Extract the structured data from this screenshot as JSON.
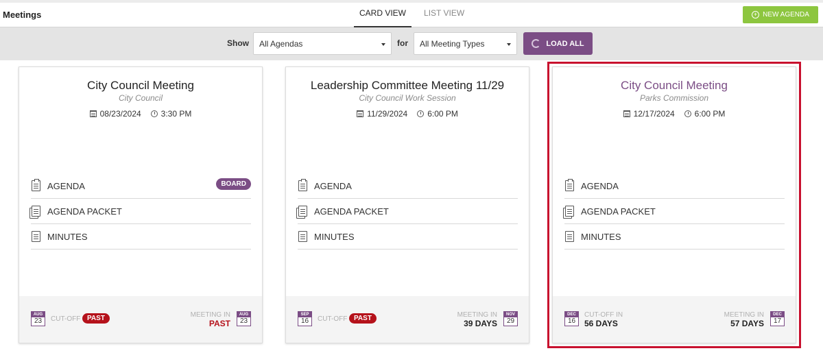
{
  "header": {
    "title": "Meetings",
    "tabs": [
      {
        "label": "CARD VIEW",
        "active": true
      },
      {
        "label": "LIST VIEW",
        "active": false
      }
    ],
    "new_agenda_label": "NEW AGENDA",
    "new_agenda_icon": "plus-circle-icon"
  },
  "filters": {
    "show_label": "Show",
    "agenda_select_value": "All Agendas",
    "for_label": "for",
    "type_select_value": "All Meeting Types",
    "load_all_label": "LOAD ALL"
  },
  "colors": {
    "accent": "#7b4d85",
    "new_agenda": "#8dc63f",
    "past": "#b5121b",
    "highlight_frame": "#c8102e"
  },
  "cards": [
    {
      "title": "City Council Meeting",
      "subtitle": "City Council",
      "date": "08/23/2024",
      "time": "3:30 PM",
      "docs": [
        {
          "label": "AGENDA",
          "badge": "BOARD"
        },
        {
          "label": "AGENDA PACKET"
        },
        {
          "label": "MINUTES"
        }
      ],
      "footer": {
        "cutoff_month": "AUG",
        "cutoff_day": "23",
        "cutoff_label": "CUT-OFF",
        "cutoff_status": "PAST",
        "meeting_in_label": "MEETING IN",
        "meeting_in_value": "PAST",
        "meeting_month": "AUG",
        "meeting_day": "23"
      }
    },
    {
      "title": "Leadership Committee Meeting 11/29",
      "subtitle": "City Council Work Session",
      "date": "11/29/2024",
      "time": "6:00 PM",
      "docs": [
        {
          "label": "AGENDA"
        },
        {
          "label": "AGENDA PACKET"
        },
        {
          "label": "MINUTES"
        }
      ],
      "footer": {
        "cutoff_month": "SEP",
        "cutoff_day": "16",
        "cutoff_label": "CUT-OFF",
        "cutoff_status": "PAST",
        "meeting_in_label": "MEETING IN",
        "meeting_in_value": "39 DAYS",
        "meeting_month": "NOV",
        "meeting_day": "29"
      }
    },
    {
      "title": "City Council Meeting",
      "subtitle": "Parks Commission",
      "date": "12/17/2024",
      "time": "6:00 PM",
      "docs": [
        {
          "label": "AGENDA"
        },
        {
          "label": "AGENDA PACKET"
        },
        {
          "label": "MINUTES"
        }
      ],
      "footer": {
        "cutoff_month": "DEC",
        "cutoff_day": "16",
        "cutoff_label": "CUT-OFF IN",
        "cutoff_value": "56 DAYS",
        "meeting_in_label": "MEETING IN",
        "meeting_in_value": "57 DAYS",
        "meeting_month": "DEC",
        "meeting_day": "17"
      }
    }
  ]
}
